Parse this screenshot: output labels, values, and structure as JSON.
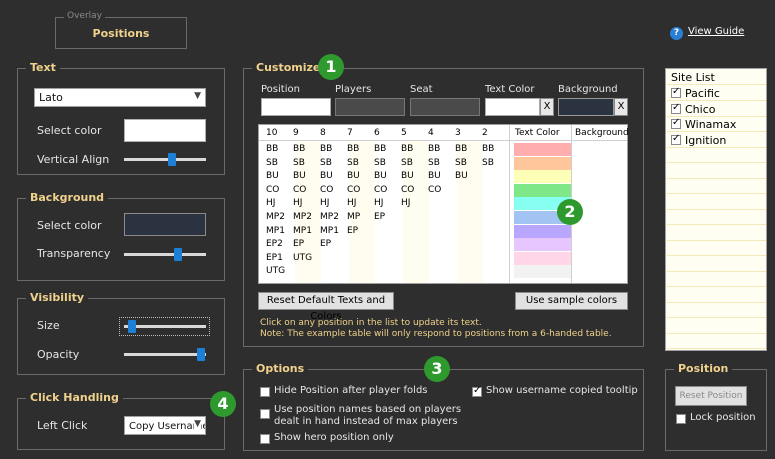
{
  "overlay": {
    "legend": "Overlay",
    "title": "Positions"
  },
  "guide": {
    "label": "View Guide"
  },
  "text_group": {
    "legend": "Text",
    "font": "Lato",
    "select_color": "Select color",
    "vertical_align": "Vertical Align"
  },
  "background_group": {
    "legend": "Background",
    "select_color": "Select color",
    "transparency": "Transparency"
  },
  "visibility_group": {
    "legend": "Visibility",
    "size": "Size",
    "opacity": "Opacity"
  },
  "click_group": {
    "legend": "Click Handling",
    "left_click": "Left Click",
    "left_click_value": "Copy Username"
  },
  "customize": {
    "legend": "Customize",
    "fields": {
      "position": "Position",
      "players": "Players",
      "seat": "Seat",
      "text_color": "Text Color",
      "background": "Background",
      "clear": "X"
    },
    "table": {
      "headers": [
        "10",
        "9",
        "8",
        "7",
        "6",
        "5",
        "4",
        "3",
        "2"
      ],
      "text_color_header": "Text Color",
      "background_header": "Background",
      "columns": [
        [
          "BB",
          "SB",
          "BU",
          "CO",
          "HJ",
          "MP2",
          "MP1",
          "EP2",
          "EP1",
          "UTG"
        ],
        [
          "BB",
          "SB",
          "BU",
          "CO",
          "HJ",
          "MP2",
          "MP1",
          "EP",
          "UTG"
        ],
        [
          "BB",
          "SB",
          "BU",
          "CO",
          "HJ",
          "MP2",
          "MP1",
          "EP"
        ],
        [
          "BB",
          "SB",
          "BU",
          "CO",
          "HJ",
          "MP",
          "EP"
        ],
        [
          "BB",
          "SB",
          "BU",
          "CO",
          "HJ",
          "EP"
        ],
        [
          "BB",
          "SB",
          "BU",
          "CO",
          "HJ"
        ],
        [
          "BB",
          "SB",
          "BU",
          "CO"
        ],
        [
          "BB",
          "SB",
          "BU"
        ],
        [
          "BB",
          "SB"
        ]
      ],
      "swatches": [
        "#ffadad",
        "#ffc59b",
        "#fdffb6",
        "#7ee787",
        "#86fff0",
        "#a3c4f3",
        "#b8a6ff",
        "#e7c6ff",
        "#ffd6e8",
        "#f2f2f2"
      ]
    },
    "reset_button": "Reset Default Texts and Colors",
    "sample_button": "Use sample colors",
    "note1": "Click on any position in the list to update its text.",
    "note2": "Note: The example table will only respond to positions from a 6-handed table."
  },
  "options": {
    "legend": "Options",
    "hide_after_folds": "Hide Position after player folds",
    "use_names_1": "Use position names based on players",
    "use_names_2": "dealt in hand instead of max players",
    "hero_only": "Show hero position only",
    "show_tooltip": "Show username copied tooltip"
  },
  "site_list": {
    "header": "Site List",
    "items": [
      "Pacific",
      "Chico",
      "Winamax",
      "Ignition"
    ]
  },
  "position_group": {
    "legend": "Position",
    "reset": "Reset Position",
    "lock": "Lock position"
  },
  "badges": [
    "1",
    "2",
    "3",
    "4"
  ]
}
